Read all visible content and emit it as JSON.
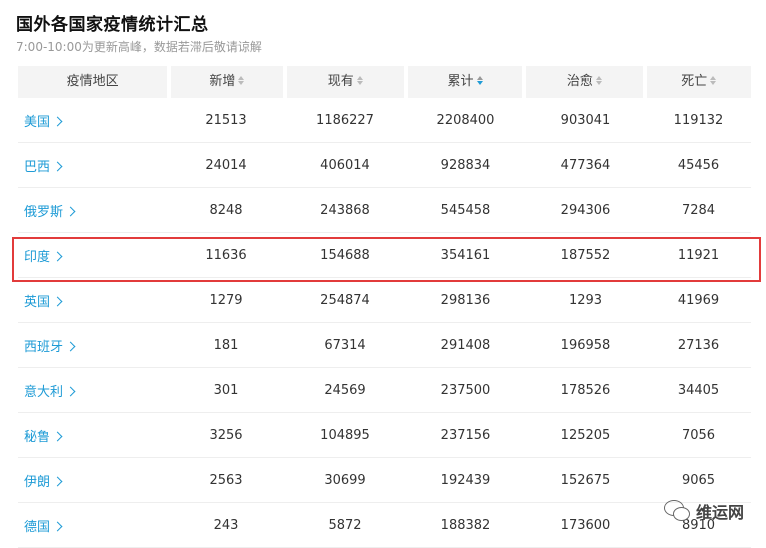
{
  "page": {
    "title": "国外各国家疫情统计汇总",
    "subtitle": "7:00-10:00为更新高峰，数据若滞后敬请谅解"
  },
  "table": {
    "headers": [
      "疫情地区",
      "新增",
      "现有",
      "累计",
      "治愈",
      "死亡"
    ],
    "sort_icon": "sort-arrows-icon",
    "active_sort": "累计",
    "rows": [
      {
        "region": "美国",
        "new": "21513",
        "current": "1186227",
        "total": "2208400",
        "cured": "903041",
        "deaths": "119132"
      },
      {
        "region": "巴西",
        "new": "24014",
        "current": "406014",
        "total": "928834",
        "cured": "477364",
        "deaths": "45456"
      },
      {
        "region": "俄罗斯",
        "new": "8248",
        "current": "243868",
        "total": "545458",
        "cured": "294306",
        "deaths": "7284"
      },
      {
        "region": "印度",
        "new": "11636",
        "current": "154688",
        "total": "354161",
        "cured": "187552",
        "deaths": "11921"
      },
      {
        "region": "英国",
        "new": "1279",
        "current": "254874",
        "total": "298136",
        "cured": "1293",
        "deaths": "41969"
      },
      {
        "region": "西班牙",
        "new": "181",
        "current": "67314",
        "total": "291408",
        "cured": "196958",
        "deaths": "27136"
      },
      {
        "region": "意大利",
        "new": "301",
        "current": "24569",
        "total": "237500",
        "cured": "178526",
        "deaths": "34405"
      },
      {
        "region": "秘鲁",
        "new": "3256",
        "current": "104895",
        "total": "237156",
        "cured": "125205",
        "deaths": "7056"
      },
      {
        "region": "伊朗",
        "new": "2563",
        "current": "30699",
        "total": "192439",
        "cured": "152675",
        "deaths": "9065"
      },
      {
        "region": "德国",
        "new": "243",
        "current": "5872",
        "total": "188382",
        "cured": "173600",
        "deaths": "8910"
      }
    ],
    "highlighted_region": "印度",
    "highlight_color": "#e23b3b",
    "link_color": "#1e9bd6"
  },
  "watermark": {
    "icon": "wechat-icon",
    "text": "维运网"
  }
}
